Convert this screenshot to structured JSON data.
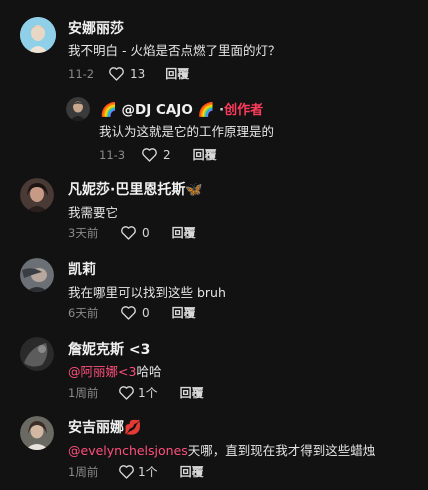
{
  "comments": [
    {
      "name": "安娜丽莎",
      "text": "我不明白 - 火焰是否点燃了里面的灯？",
      "date": "11-2",
      "likes": "13",
      "reply": "回覆"
    },
    {
      "name": "🌈 @DJ CAJO 🌈",
      "dot": "·",
      "creator": "创作者",
      "text": "我认为这就是它的工作原理是的",
      "date": "11-3",
      "likes": "2",
      "reply": "回覆"
    },
    {
      "name": "凡妮莎·巴里恩托斯🦋",
      "text": "我需要它",
      "date": "3天前",
      "likes": "0",
      "reply": "回覆"
    },
    {
      "name": "凯莉",
      "text": "我在哪里可以找到这些 bruh",
      "date": "6天前",
      "likes": "0",
      "reply": "回覆"
    },
    {
      "name": "詹妮克斯 <3",
      "mention": "@阿丽娜<3",
      "text": "哈哈",
      "date": "1周前",
      "likes": "1个",
      "reply": "回覆"
    },
    {
      "name": "安吉丽娜💋",
      "mention": "@evelynchelsjones",
      "text": "天哪，直到现在我才得到这些蜡烛",
      "date": "1周前",
      "likes": "1个",
      "reply": "回覆"
    }
  ],
  "icons": {
    "like": "heart-outline-icon"
  },
  "colors": {
    "background": "#121212",
    "mention": "#ff4f7b",
    "creator": "#ff3b5c"
  }
}
